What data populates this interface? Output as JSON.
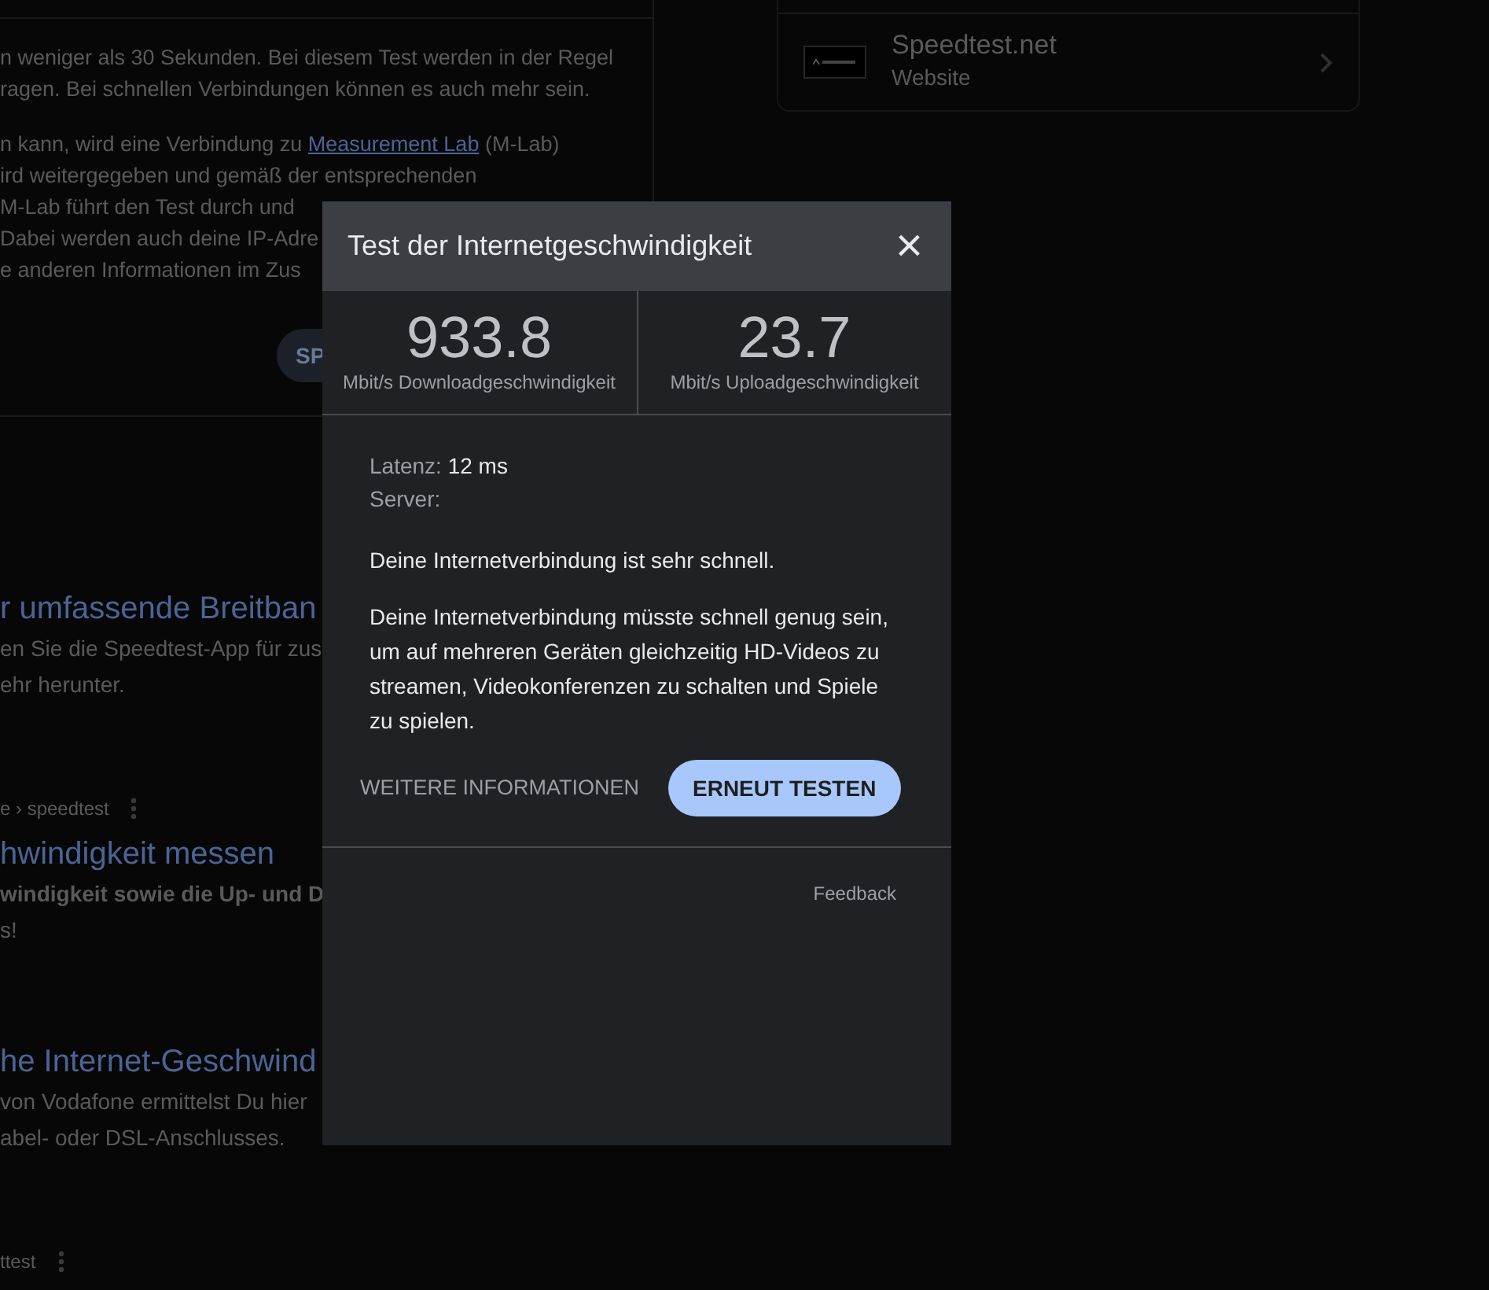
{
  "page": {
    "intro_lines": [
      "n weniger als 30 Sekunden. Bei diesem Test werden in der Regel",
      "ragen. Bei schnellen Verbindungen können es auch mehr sein."
    ],
    "info": {
      "before": "n kann, wird eine Verbindung zu ",
      "link": "Measurement Lab",
      "after": " (M-Lab)",
      "lines": [
        "ird weitergegeben und gemäß der entsprechenden",
        "M-Lab führt den Test durch und",
        "Dabei werden auch deine IP-Adre",
        "e anderen Informationen im Zus"
      ]
    },
    "start_button": "SP",
    "side_card": {
      "title": "Speedtest.net",
      "subtitle": "Website"
    },
    "results": [
      {
        "title": "r umfassende Breitban",
        "lines": [
          {
            "text": "en Sie die Speedtest-App für zus",
            "bold": false
          },
          {
            "text": "ehr herunter.",
            "bold": false
          }
        ]
      },
      {
        "url": "e › speedtest",
        "title": "hwindigkeit messen",
        "lines": [
          {
            "text": "windigkeit sowie die Up- und D",
            "bold": true
          },
          {
            "text": "s!",
            "bold": false
          }
        ]
      },
      {
        "title": "he Internet-Geschwind",
        "lines": [
          {
            "text": "von Vodafone ermittelst Du hier",
            "bold": false
          },
          {
            "text": "abel- oder DSL-Anschlusses.",
            "bold": false
          }
        ]
      },
      {
        "url": "ttest"
      }
    ]
  },
  "dialog": {
    "title": "Test der Internetgeschwindigkeit",
    "close": "×",
    "stats": [
      {
        "value": "933.8",
        "label": "Mbit/s Downloadgeschwindigkeit"
      },
      {
        "value": "23.7",
        "label": "Mbit/s Uploadgeschwindigkeit"
      }
    ],
    "details": [
      {
        "label": "Latenz:",
        "value": "12 ms"
      },
      {
        "label": "Server:"
      }
    ],
    "messages": [
      "Deine Internetverbindung ist sehr schnell.",
      "Deine Internetverbindung müsste schnell genug sein, um auf mehreren Geräten gleichzeitig HD-Videos zu streamen, Videokonferenzen zu schalten und Spiele zu spielen."
    ],
    "more_button": "WEITERE INFORMATIONEN",
    "retest_button": "ERNEUT TESTEN",
    "feedback": "Feedback"
  }
}
